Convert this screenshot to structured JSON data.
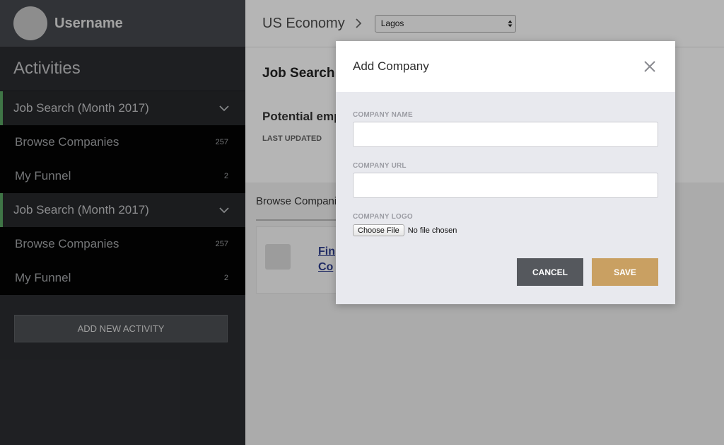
{
  "sidebar": {
    "username": "Username",
    "activities_title": "Activities",
    "groups": [
      {
        "title": "Job Search (Month 2017)",
        "items": [
          {
            "label": "Browse Companies",
            "count": "257"
          },
          {
            "label": "My Funnel",
            "count": "2"
          }
        ]
      },
      {
        "title": "Job Search (Month 2017)",
        "items": [
          {
            "label": "Browse Companies",
            "count": "257"
          },
          {
            "label": "My Funnel",
            "count": "2"
          }
        ]
      }
    ],
    "add_button": "ADD NEW ACTIVITY",
    "accent_color": "#5aa563"
  },
  "topbar": {
    "breadcrumb": "US Economy",
    "location_select": "Lagos"
  },
  "main": {
    "page_title": "Job Search (",
    "section_title": "Potential emp",
    "last_updated_label": "LAST UPDATED",
    "browse_label": "Browse Compani",
    "card_link_line1": "Fin",
    "card_link_line2": "Co"
  },
  "modal": {
    "title": "Add Company",
    "company_name_label": "COMPANY NAME",
    "company_name_value": "",
    "company_url_label": "COMPANY URL",
    "company_url_value": "",
    "company_logo_label": "COMPANY LOGO",
    "choose_file_label": "Choose File",
    "file_status": "No file chosen",
    "cancel_label": "CANCEL",
    "save_label": "SAVE",
    "save_color": "#c9a062",
    "cancel_color": "#55585d"
  }
}
